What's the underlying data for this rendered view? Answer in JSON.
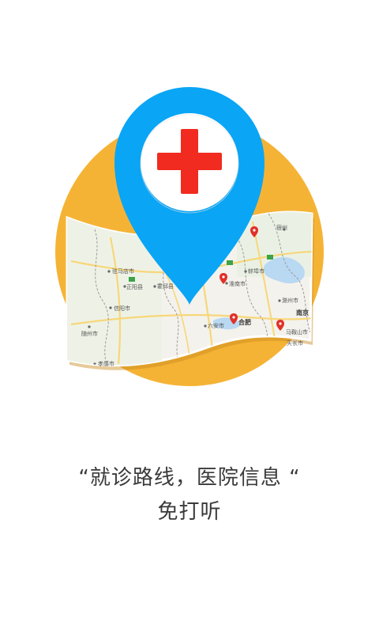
{
  "colors": {
    "background": "#ffffff",
    "circle": "#F5B335",
    "pin": "#0AA5F5",
    "pin_inner": "#ffffff",
    "cross": "#F12B1F",
    "text": "#3a3a3a",
    "marker": "#E0312A"
  },
  "icons": {
    "pin": "location-pin-icon",
    "cross": "medical-cross-icon"
  },
  "map": {
    "labels": [
      "驻马店市",
      "正阳县",
      "信阳市",
      "随州市",
      "孝感市",
      "霍邱县",
      "淮南市",
      "六安市",
      "合肥",
      "滁州市",
      "南京",
      "马鞍山市",
      "蚌埠市",
      "宿州",
      "天长市"
    ]
  },
  "caption": {
    "line1": "“就诊路线，医院信息 “",
    "line2": "免打听"
  }
}
